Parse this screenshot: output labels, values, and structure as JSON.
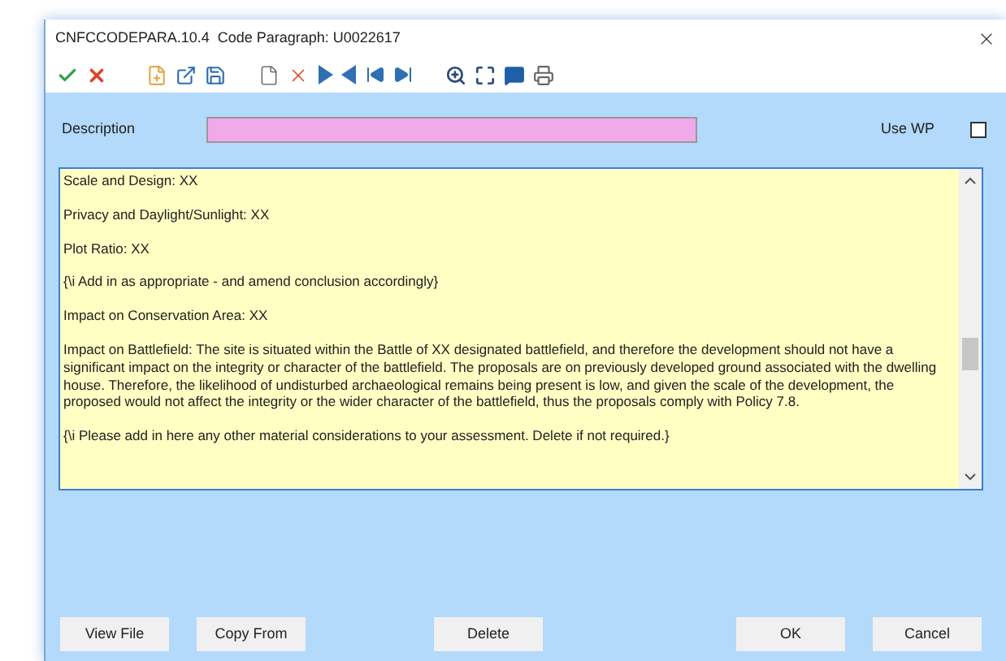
{
  "window": {
    "title": "CNFCCODEPARA.10.4  Code Paragraph: U0022617"
  },
  "description": {
    "label": "Description"
  },
  "use_wp": {
    "label": "Use WP",
    "checked": false
  },
  "paragraphs": [
    "Scale and Design: XX",
    "Privacy and Daylight/Sunlight: XX",
    "Plot Ratio: XX",
    "{\\i Add in as appropriate - and amend conclusion accordingly}",
    "Impact on Conservation Area: XX",
    "Impact on Battlefield: The site is situated within the Battle of XX designated battlefield, and therefore the development should not have a significant impact on the integrity or character of the battlefield. The proposals are on previously developed ground associated with the dwelling house. Therefore, the likelihood of undisturbed archaeological remains being present is low, and given the scale of the development, the proposed would not affect the integrity or the wider character of the battlefield, thus the proposals comply with Policy 7.8.",
    "{\\i Please add in here any other material considerations to your assessment. Delete if not required.}"
  ],
  "left_buttons": [
    "View File",
    "Copy From"
  ],
  "center_buttons": [
    "Delete"
  ],
  "right_buttons": [
    "OK",
    "Cancel"
  ]
}
